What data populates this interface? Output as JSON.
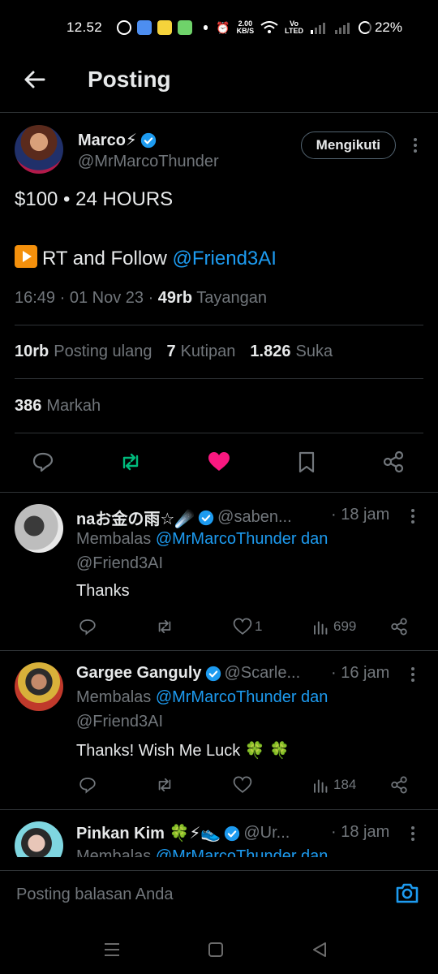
{
  "status_bar": {
    "time": "12.52",
    "data_speed_value": "2.00",
    "data_speed_unit": "KB/S",
    "network_label_top": "Vo",
    "network_label_bottom": "LTED",
    "battery": "22%"
  },
  "header": {
    "title": "Posting"
  },
  "post": {
    "author_name": "Marco⚡",
    "author_handle": "@MrMarcoThunder",
    "follow_label": "Mengikuti",
    "line1": "$100 • 24 HOURS",
    "line2_prefix": "RT and Follow ",
    "line2_mention": "@Friend3AI",
    "time": "16:49",
    "date": "01 Nov 23",
    "views_count": "49rb",
    "views_label": "Tayangan",
    "reposts_count": "10rb",
    "reposts_label": "Posting ulang",
    "quotes_count": "7",
    "quotes_label": "Kutipan",
    "likes_count": "1.826",
    "likes_label": "Suka",
    "bookmarks_count": "386",
    "bookmarks_label": "Markah"
  },
  "replies": [
    {
      "name": "naお金の雨☆☄️",
      "handle": "@saben...",
      "time": "18 jam",
      "replying_prefix": "Membalas ",
      "replying_to": "@MrMarcoThunder dan",
      "replying_to_2": "@Friend3AI",
      "text": "Thanks",
      "likes": "1",
      "views": "699"
    },
    {
      "name": "Gargee Ganguly",
      "handle": "@Scarle...",
      "time": "16 jam",
      "replying_prefix": "Membalas ",
      "replying_to": "@MrMarcoThunder dan",
      "replying_to_2": "@Friend3AI",
      "text": "Thanks! Wish Me Luck 🍀 🍀",
      "likes": "",
      "views": "184"
    },
    {
      "name": "Pinkan Kim 🍀⚡👟",
      "handle": "@Ur...",
      "time": "18 jam",
      "replying_prefix": "Membalas ",
      "replying_to": "@MrMarcoThunder dan"
    }
  ],
  "composer": {
    "placeholder": "Posting balasan Anda"
  },
  "colors": {
    "accent": "#1d9bf0",
    "repost_active": "#00ba7c",
    "like_active": "#f91880",
    "muted": "#71767b"
  }
}
